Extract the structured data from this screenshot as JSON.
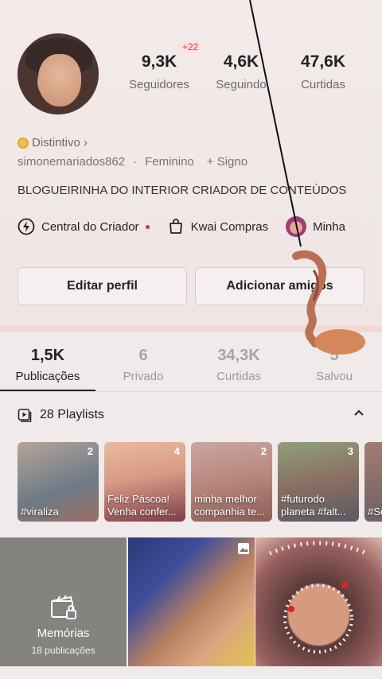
{
  "profile": {
    "stats": [
      {
        "value": "9,3K",
        "label": "Seguidores"
      },
      {
        "value": "4,6K",
        "label": "Seguindo"
      },
      {
        "value": "47,6K",
        "label": "Curtidas"
      }
    ],
    "new_followers_badge": "+22",
    "distintivo": "Distintivo",
    "distintivo_chevron": "›",
    "username": "simonemariados862",
    "separator": "·",
    "gender": "Feminino",
    "sign_add": "+ Signo",
    "bio": "BLOGUEIRINHA DO INTERIOR CRIADOR DE CONTEÚDOS"
  },
  "shortcuts": [
    {
      "label": "Central do Criador",
      "icon": "lightning-icon"
    },
    {
      "label": "Kwai Compras",
      "icon": "shopping-bag-icon"
    },
    {
      "label": "Minha",
      "icon": "avatar"
    }
  ],
  "buttons": {
    "edit_profile": "Editar perfil",
    "add_friends": "Adicionar amigos"
  },
  "tabs": [
    {
      "value": "1,5K",
      "label": "Publicações"
    },
    {
      "value": "6",
      "label": "Privado"
    },
    {
      "value": "34,3K",
      "label": "Curtidas"
    },
    {
      "value": "5",
      "label": "Salvou"
    }
  ],
  "playlists": {
    "header": "28 Playlists",
    "items": [
      {
        "count": "2",
        "title": "#viraliza"
      },
      {
        "count": "4",
        "title": "Feliz Páscoa! Venha confer..."
      },
      {
        "count": "2",
        "title": "minha melhor companhia te..."
      },
      {
        "count": "3",
        "title": "#futurodo planeta #falt..."
      },
      {
        "count": "",
        "title": "#Se #G"
      }
    ]
  },
  "grid": {
    "memorias_title": "Memórias",
    "memorias_count": "18 publicações"
  },
  "colors": {
    "accent_red": "#e52b2b",
    "background": "#f1e9e9"
  }
}
